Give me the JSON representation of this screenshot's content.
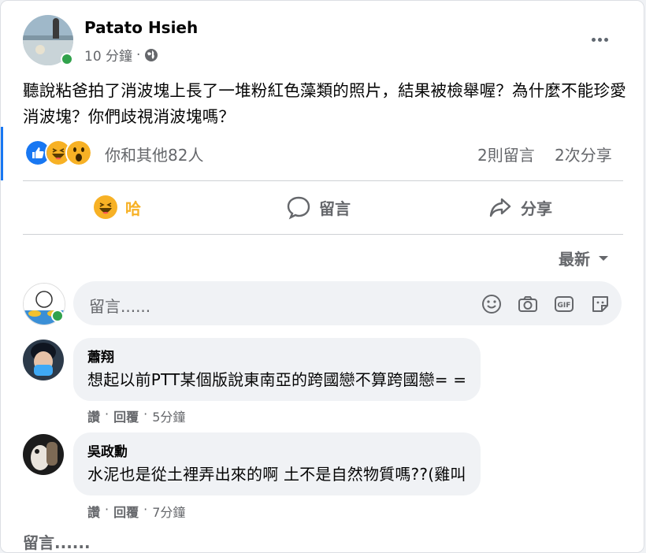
{
  "post": {
    "author": "Patato Hsieh",
    "time": "10 分鐘",
    "text": "聽說粘爸拍了消波塊上長了一堆粉紅色藻類的照片，結果被檢舉喔？為什麼不能珍愛消波塊？你們歧視消波塊嗎？",
    "reaction_icons": [
      "like-icon",
      "haha-icon",
      "wow-icon"
    ],
    "reactions_summary": "你和其他82人",
    "comments_count": "2則留言",
    "shares_count": "2次分享"
  },
  "actions": {
    "haha_label": "哈",
    "comment_label": "留言",
    "share_label": "分享"
  },
  "sort": {
    "label": "最新"
  },
  "composer": {
    "placeholder": "留言......",
    "tools": [
      "emoji-icon",
      "camera-icon",
      "gif-icon",
      "sticker-icon"
    ]
  },
  "comments": [
    {
      "name": "蕭翔",
      "text": "想起以前PTT某個版說東南亞的跨國戀不算跨國戀= =",
      "like": "讚",
      "reply": "回覆",
      "time": "5分鐘"
    },
    {
      "name": "吳政勳",
      "text": "水泥也是從土裡弄出來的啊 土不是自然物質嗎??(雞叫",
      "like": "讚",
      "reply": "回覆",
      "time": "7分鐘"
    }
  ],
  "bottom_comment_label": "留言......",
  "colors": {
    "accent": "#1877f2",
    "online": "#31a24c",
    "secondary_text": "#65676b",
    "bubble": "#f0f2f5",
    "haha": "#f7b125"
  }
}
